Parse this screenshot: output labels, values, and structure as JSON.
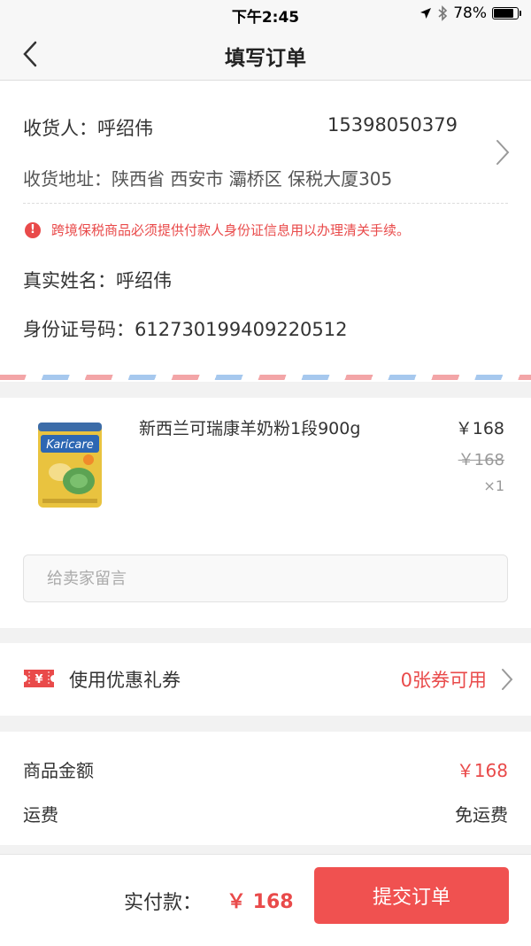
{
  "status_bar": {
    "time": "下午2:45",
    "battery": "78%",
    "battery_level": 0.78
  },
  "nav": {
    "title": "填写订单"
  },
  "address": {
    "consignee": "收货人：呼绍伟",
    "phone": "15398050379",
    "address_line": "收货地址：陕西省 西安市 灞桥区 保税大厦305",
    "warning": "跨境保税商品必须提供付款人身份证信息用以办理清关手续。",
    "real_name": "真实姓名：呼绍伟",
    "id_number": "身份证号码：612730199409220512"
  },
  "product": {
    "name": "新西兰可瑞康羊奶粉1段900g",
    "brand_text": "Karicare",
    "price": "￥168",
    "original_price": "￥168",
    "quantity": "×1"
  },
  "message": {
    "placeholder": "给卖家留言"
  },
  "coupon": {
    "icon_text": "¥",
    "label": "使用优惠礼券",
    "value": "0张券可用"
  },
  "totals": {
    "goods_label": "商品金额",
    "goods_value": "￥168",
    "shipping_label": "运费",
    "shipping_value": "免运费"
  },
  "footer": {
    "pay_label": "实付款：",
    "pay_amount": "￥ 168",
    "submit_label": "提交订单"
  },
  "colors": {
    "accent": "#f05150",
    "warning": "#e94a4a"
  }
}
